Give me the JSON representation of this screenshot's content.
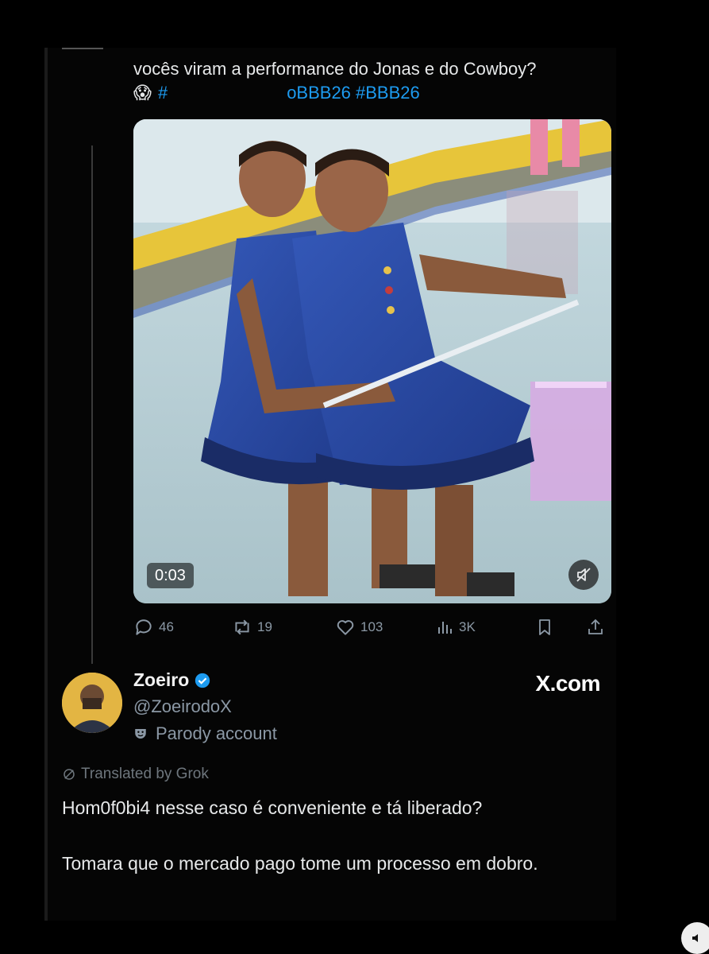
{
  "tweet": {
    "text_line1": "vocês viram a performance do Jonas e do Cowboy?",
    "emoji": "😱",
    "hashtag_prefix": "#",
    "hashtag_fragment": "oBBB26 #BBB26",
    "video_time": "0:03"
  },
  "actions": {
    "replies": "46",
    "reposts": "19",
    "likes": "103",
    "views": "3K"
  },
  "quote": {
    "author_name": "Zoeiro",
    "author_handle": "@ZoeirodoX",
    "parody_label": "Parody account",
    "watermark": "X.com",
    "translated_label": "Translated by Grok",
    "paragraph1": "Hom0f0bi4 nesse caso é conveniente e tá liberado?",
    "paragraph2": "Tomara que o mercado pago tome um processo em dobro."
  },
  "colors": {
    "link": "#1d9bf0",
    "muted": "#8b98a5",
    "verified": "#1d9bf0",
    "background": "#000000"
  },
  "icons": [
    "reply-icon",
    "repost-icon",
    "like-icon",
    "views-icon",
    "bookmark-icon",
    "share-icon",
    "mute-icon",
    "verified-icon",
    "parody-mask-icon",
    "grok-icon"
  ]
}
